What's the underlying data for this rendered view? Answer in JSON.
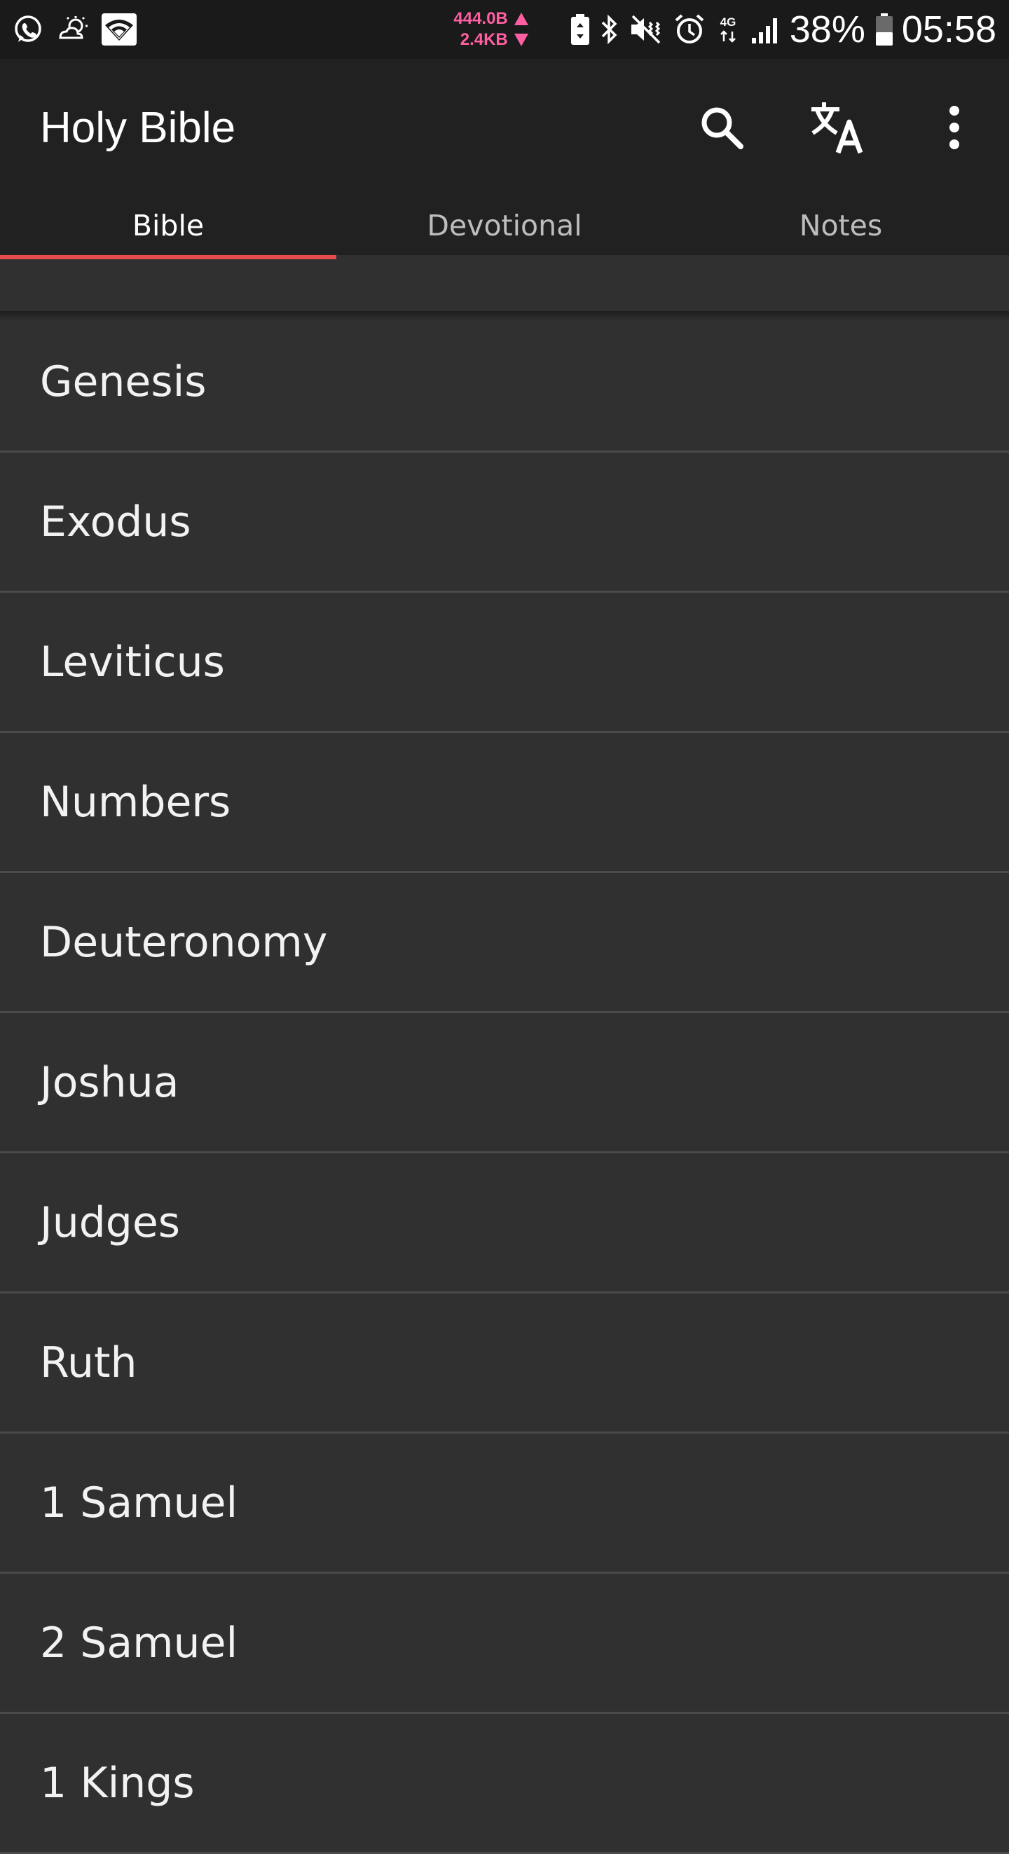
{
  "status_bar": {
    "upload_speed": "444.0B",
    "download_speed": "2.4KB",
    "battery_percent": "38%",
    "time": "05:58",
    "network_type": "4G",
    "speed_color": "#ff5fa2"
  },
  "app_bar": {
    "title": "Holy Bible",
    "actions": [
      "search-icon",
      "translate-icon",
      "more-vert-icon"
    ]
  },
  "tabs": [
    {
      "label": "Bible",
      "active": true
    },
    {
      "label": "Devotional",
      "active": false
    },
    {
      "label": "Notes",
      "active": false
    }
  ],
  "accent_color": "#e84c4c",
  "books": [
    "Genesis",
    "Exodus",
    "Leviticus",
    "Numbers",
    "Deuteronomy",
    "Joshua",
    "Judges",
    "Ruth",
    "1 Samuel",
    "2 Samuel",
    "1 Kings"
  ]
}
